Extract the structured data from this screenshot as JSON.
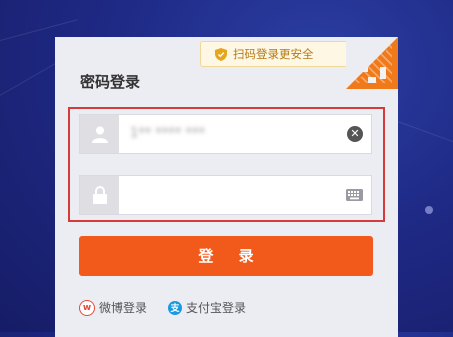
{
  "login": {
    "title": "密码登录",
    "qr_hint": "扫码登录更安全",
    "username_value": "1** **** ***",
    "password_placeholder": "",
    "submit_label": "登 录",
    "weibo_label": "微博登录",
    "alipay_label": "支付宝登录",
    "clear_glyph": "✕"
  },
  "colors": {
    "accent": "#f25a1b",
    "highlight_frame": "#d63b3b",
    "qr_orange": "#f07a1a",
    "background": "#1f2a86"
  },
  "icons": [
    "shield-icon",
    "qr-code-icon",
    "user-icon",
    "lock-icon",
    "clear-icon",
    "keyboard-icon",
    "weibo-icon",
    "alipay-icon"
  ]
}
